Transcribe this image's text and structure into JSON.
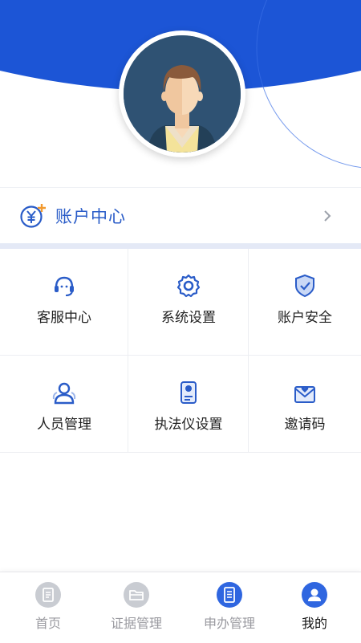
{
  "colors": {
    "header_blue": "#1c55d6",
    "accent_blue": "#2a5cc8",
    "accent_orange": "#f29a2e",
    "tab_inactive": "#c9ccd2",
    "tab_active": "#2f66e0"
  },
  "profile": {
    "avatar_icon": "user-avatar-illustration"
  },
  "account": {
    "label": "账户中心",
    "icon": "yen-plus-icon",
    "chevron_icon": "chevron-right-icon"
  },
  "menu": {
    "items": [
      {
        "label": "客服中心",
        "icon": "headset-icon"
      },
      {
        "label": "系统设置",
        "icon": "gear-icon"
      },
      {
        "label": "账户安全",
        "icon": "shield-check-icon"
      },
      {
        "label": "人员管理",
        "icon": "people-icon"
      },
      {
        "label": "执法仪设置",
        "icon": "recorder-icon"
      },
      {
        "label": "邀请码",
        "icon": "envelope-heart-icon"
      }
    ]
  },
  "tabbar": {
    "items": [
      {
        "label": "首页",
        "icon": "home-doc-icon",
        "active": false
      },
      {
        "label": "证据管理",
        "icon": "folder-icon",
        "active": false
      },
      {
        "label": "申办管理",
        "icon": "document-list-icon",
        "active": true
      },
      {
        "label": "我的",
        "icon": "user-icon",
        "active": true
      }
    ]
  }
}
